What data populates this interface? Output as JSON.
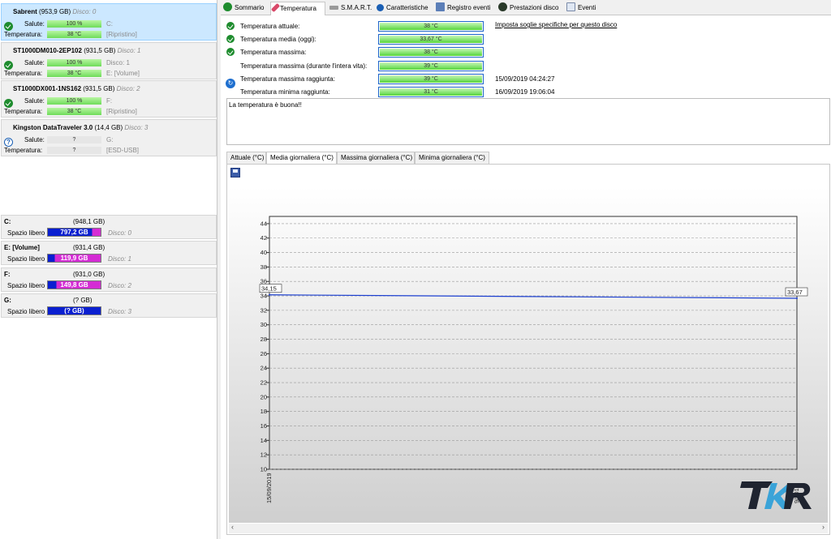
{
  "disks": [
    {
      "name": "Sabrent",
      "size": "(953,9 GB)",
      "disco": "Disco: 0",
      "salute_label": "Salute:",
      "salute": "100 %",
      "temp_label": "Temperatura:",
      "temp": "38 °C",
      "letter": "C:",
      "extra": "[Ripristino]",
      "status": "ok"
    },
    {
      "name": "ST1000DM010-2EP102",
      "size": "(931,5 GB)",
      "disco": "Disco: 1",
      "salute_label": "Salute:",
      "salute": "100 %",
      "temp_label": "Temperatura:",
      "temp": "38 °C",
      "letter": "Disco: 1",
      "extra": "E: [Volume]",
      "status": "ok"
    },
    {
      "name": "ST1000DX001-1NS162",
      "size": "(931,5 GB)",
      "disco": "Disco: 2",
      "salute_label": "Salute:",
      "salute": "100 %",
      "temp_label": "Temperatura:",
      "temp": "38 °C",
      "letter": "F:",
      "extra": "[Ripristino]",
      "status": "ok"
    },
    {
      "name": "Kingston DataTraveler 3.0",
      "size": "(14,4 GB)",
      "disco": "Disco: 3",
      "salute_label": "Salute:",
      "salute": "?",
      "temp_label": "Temperatura:",
      "temp": "?",
      "letter": "G:",
      "extra": "[ESD-USB]",
      "status": "unknown"
    }
  ],
  "volumes": [
    {
      "name": "C:",
      "size": "(948,1 GB)",
      "free_label": "Spazio libero",
      "free": "797,2 GB",
      "disco": "Disco: 0",
      "used_fraction": 0.16
    },
    {
      "name": "E: [Volume]",
      "size": "(931,4 GB)",
      "free_label": "Spazio libero",
      "free": "119,9 GB",
      "disco": "Disco: 1",
      "used_fraction": 0.87
    },
    {
      "name": "F:",
      "size": "(931,0 GB)",
      "free_label": "Spazio libero",
      "free": "149,8 GB",
      "disco": "Disco: 2",
      "used_fraction": 0.84
    },
    {
      "name": "G:",
      "size": "(? GB)",
      "free_label": "Spazio libero",
      "free": "(? GB)",
      "disco": "Disco: 3",
      "used_fraction": 0.0
    }
  ],
  "tabs": [
    "Sommario",
    "Temperatura",
    "S.M.A.R.T.",
    "Caratteristiche",
    "Registro eventi",
    "Prestazioni disco",
    "Eventi"
  ],
  "temperature": {
    "rows": [
      {
        "label": "Temperatura attuale:",
        "value": "38 °C",
        "date": "",
        "icon": "ok"
      },
      {
        "label": "Temperatura media (oggi):",
        "value": "33,67 °C",
        "date": "",
        "icon": "ok"
      },
      {
        "label": "Temperatura massima:",
        "value": "38 °C",
        "date": "",
        "icon": "ok"
      },
      {
        "label": "Temperatura massima (durante l'intera vita):",
        "value": "39 °C",
        "date": "",
        "icon": ""
      },
      {
        "label": "Temperatura massima raggiunta:",
        "value": "39 °C",
        "date": "15/09/2019 04:24:27",
        "icon": ""
      },
      {
        "label": "Temperatura minima raggiunta:",
        "value": "31 °C",
        "date": "16/09/2019 19:06:04",
        "icon": ""
      }
    ],
    "threshold_link": "Imposta soglie specifiche per questo disco",
    "message": "La temperatura è buona!!"
  },
  "chart_tabs": [
    "Attuale (°C)",
    "Media giornaliera (°C)",
    "Massima giornaliera (°C)",
    "Minima giornaliera (°C)"
  ],
  "chart_data": {
    "type": "line",
    "x": [
      "15/09/2019",
      "16/09/2019"
    ],
    "series": [
      {
        "values": [
          34.15,
          33.67
        ]
      }
    ],
    "ylim": [
      10,
      45
    ],
    "yticks": [
      10,
      12,
      14,
      16,
      18,
      20,
      22,
      24,
      26,
      28,
      30,
      32,
      34,
      36,
      38,
      40,
      42,
      44
    ],
    "labels": {
      "start": "34,15",
      "end": "33,67"
    },
    "xtick_labels": [
      "15/09/2019",
      "9/2019"
    ],
    "grid": true,
    "line_color": "#1c3fd0"
  },
  "watermark": "TKR"
}
